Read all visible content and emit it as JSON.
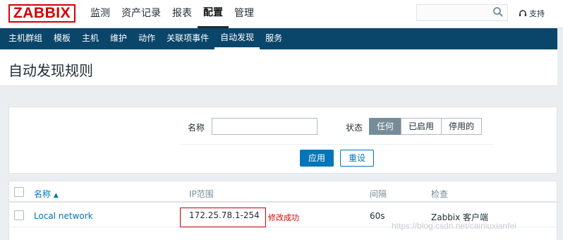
{
  "app": {
    "logo": "ZABBIX"
  },
  "main_menu": [
    "监测",
    "资产记录",
    "报表",
    "配置",
    "管理"
  ],
  "main_menu_active": "配置",
  "header": {
    "search_placeholder": "",
    "support_label": "支持"
  },
  "sub_menu": [
    "主机群组",
    "模板",
    "主机",
    "维护",
    "动作",
    "关联项事件",
    "自动发现",
    "服务"
  ],
  "sub_menu_active": "自动发现",
  "page": {
    "title": "自动发现规则"
  },
  "filter": {
    "name_label": "名称",
    "name_value": "",
    "status_label": "状态",
    "status_options": [
      "任何",
      "已启用",
      "停用的"
    ],
    "status_selected": "任何",
    "apply_label": "应用",
    "reset_label": "重设"
  },
  "table": {
    "columns": [
      "名称",
      "IP范围",
      "间隔",
      "检查"
    ],
    "sort_indicator": "▲",
    "rows": [
      {
        "name": "Local network",
        "ip_range": "172.25.78.1-254",
        "interval": "60s",
        "checks": "Zabbix 客户端"
      }
    ]
  },
  "annotation": {
    "text": "修改成功",
    "color": "#e00000"
  },
  "watermark": "https://blog.csdn.net/cainiuxianfei",
  "colors": {
    "brand": "#d40000",
    "nav_bg": "#0a466a",
    "link": "#0275b8",
    "segment_active": "#768d99"
  }
}
